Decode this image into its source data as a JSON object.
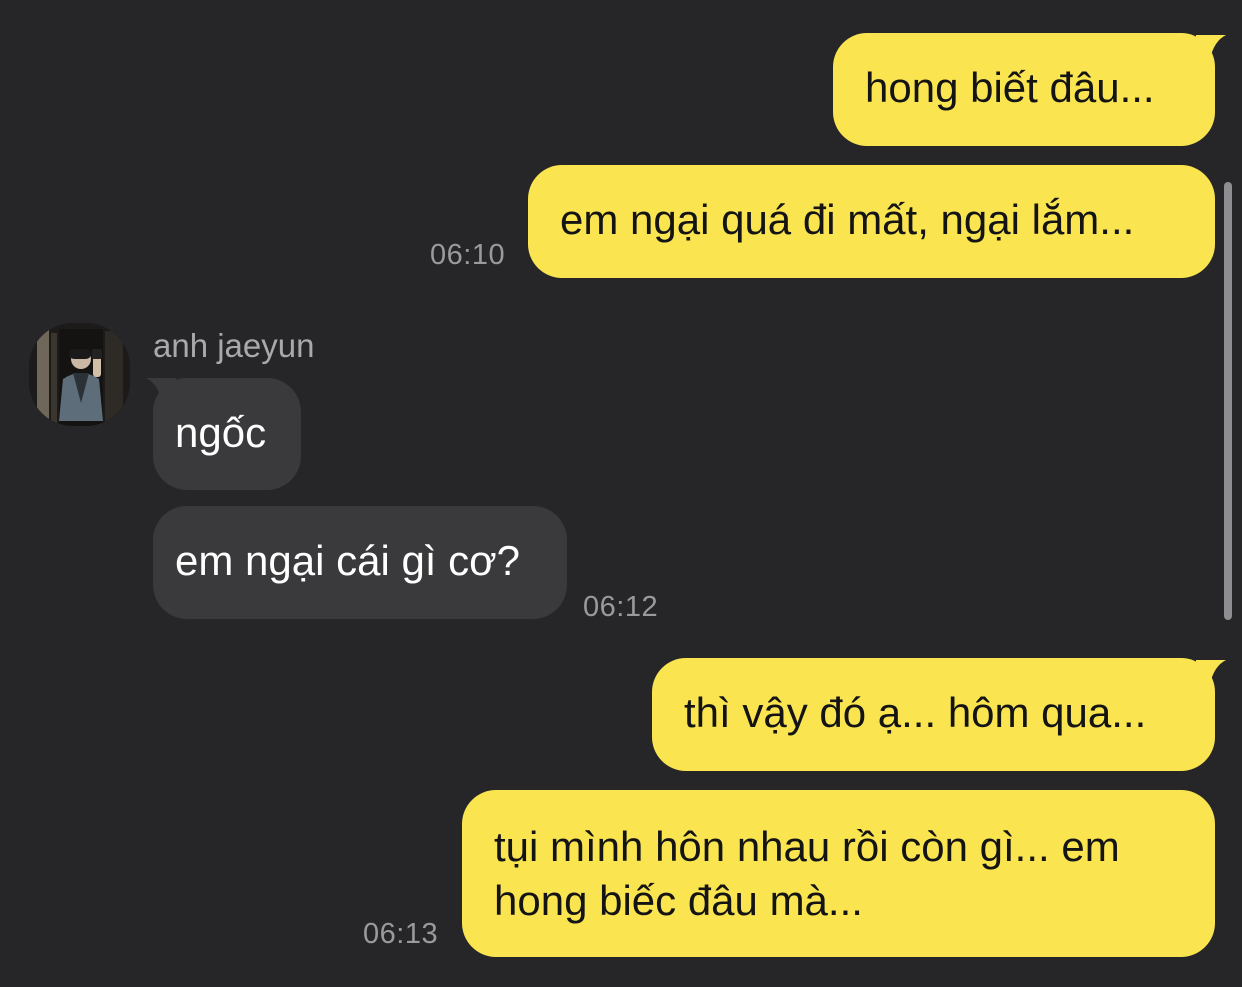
{
  "conversation": {
    "messages": [
      {
        "direction": "outgoing",
        "text": "hong biết đâu..."
      },
      {
        "direction": "outgoing",
        "text": "em ngại quá đi mất, ngại lắm...",
        "time": "06:10"
      },
      {
        "direction": "incoming",
        "sender": "anh jaeyun",
        "text": "ngốc"
      },
      {
        "direction": "incoming",
        "text": "em ngại cái gì cơ?",
        "time": "06:12"
      },
      {
        "direction": "outgoing",
        "text": "thì vậy đó ạ... hôm qua..."
      },
      {
        "direction": "outgoing",
        "text_line1": "tụi mình hôn nhau rồi còn gì... em",
        "text_line2": "hong biếc đâu mà...",
        "time": "06:13"
      }
    ]
  },
  "colors": {
    "background": "#262628",
    "outgoing_bubble": "#fae551",
    "incoming_bubble": "#3a3a3c",
    "timestamp": "#9a9a9c"
  },
  "icons": {
    "avatar": "profile-photo"
  }
}
